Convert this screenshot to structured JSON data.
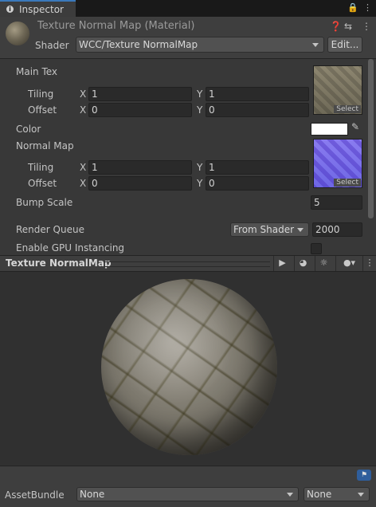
{
  "tab": {
    "label": "Inspector",
    "icon": "info-icon"
  },
  "header": {
    "title": "Texture Normal Map (Material)",
    "shader_label": "Shader",
    "shader_value": "WCC/Texture NormalMap",
    "edit_label": "Edit...",
    "icons": [
      "help-icon",
      "preset-icon",
      "more-icon"
    ]
  },
  "main_tex": {
    "label": "Main Tex",
    "tiling_label": "Tiling",
    "offset_label": "Offset",
    "x_label": "X",
    "y_label": "Y",
    "tiling_x": "1",
    "tiling_y": "1",
    "offset_x": "0",
    "offset_y": "0",
    "select_label": "Select"
  },
  "color": {
    "label": "Color",
    "value": "#ffffff"
  },
  "normal_map": {
    "label": "Normal Map",
    "tiling_label": "Tiling",
    "offset_label": "Offset",
    "x_label": "X",
    "y_label": "Y",
    "tiling_x": "1",
    "tiling_y": "1",
    "offset_x": "0",
    "offset_y": "0",
    "select_label": "Select"
  },
  "bump_scale": {
    "label": "Bump Scale",
    "value": "5"
  },
  "render_queue": {
    "label": "Render Queue",
    "mode": "From Shader",
    "value": "2000"
  },
  "gpu_instancing": {
    "label": "Enable GPU Instancing",
    "checked": false
  },
  "preview": {
    "title": "Texture NormalMap"
  },
  "asset_bundle": {
    "label": "AssetBundle",
    "name": "None",
    "variant": "None"
  }
}
